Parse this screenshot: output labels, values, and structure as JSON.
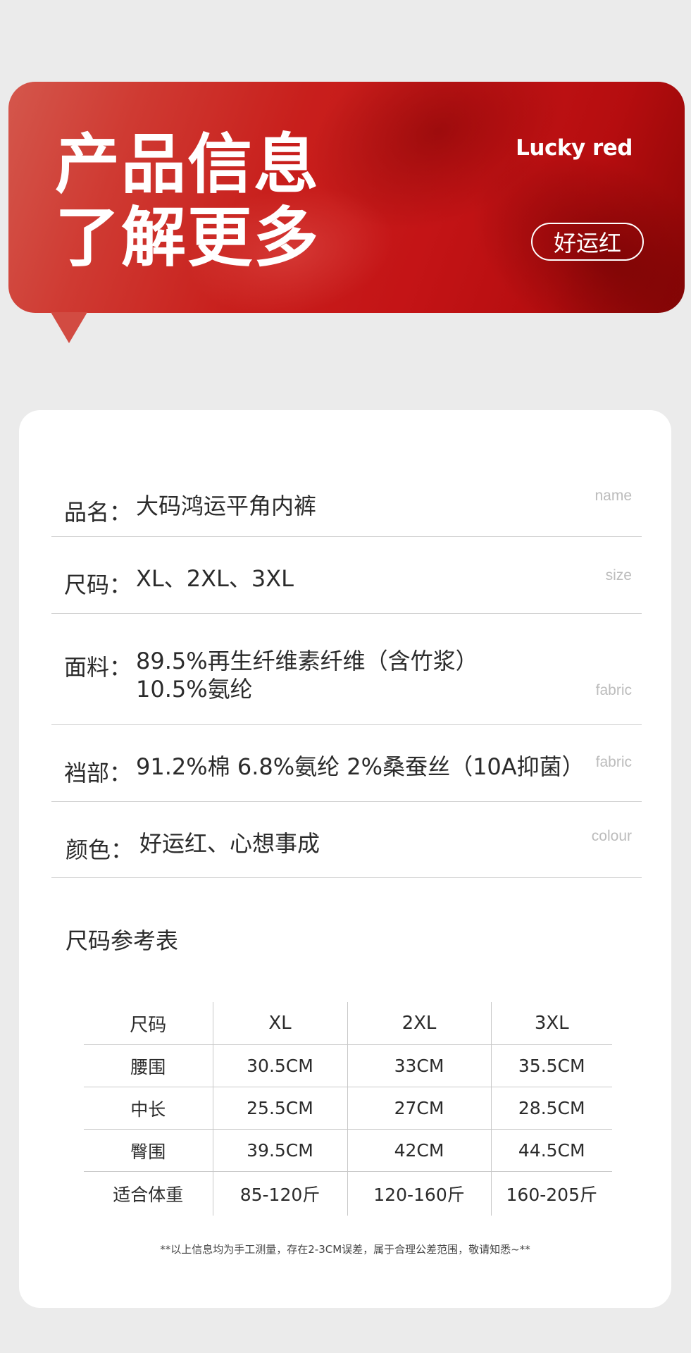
{
  "banner": {
    "title_line1": "产品信息",
    "title_line2": "了解更多",
    "english": "Lucky red",
    "pill": "好运红",
    "color": "#c41416"
  },
  "info": [
    {
      "key": "品名：",
      "value": "大码鸿运平角内裤",
      "en": "name"
    },
    {
      "key": "尺码：",
      "value": "XL、2XL、3XL",
      "en": "size"
    },
    {
      "key": "面料：",
      "value": "89.5%再生纤维素纤维（含竹浆）",
      "value2": "10.5%氨纶",
      "en": "fabric"
    },
    {
      "key": "裆部：",
      "value": "91.2%棉 6.8%氨纶  2%桑蚕丝（10A抑菌）",
      "en": "fabric"
    },
    {
      "key": "颜色：",
      "value": "好运红、心想事成",
      "en": "colour"
    }
  ],
  "size_chart": {
    "title": "尺码参考表",
    "headers": [
      "尺码",
      "XL",
      "2XL",
      "3XL"
    ],
    "rows": [
      [
        "腰围",
        "30.5CM",
        "33CM",
        "35.5CM"
      ],
      [
        "中长",
        "25.5CM",
        "27CM",
        "28.5CM"
      ],
      [
        "臀围",
        "39.5CM",
        "42CM",
        "44.5CM"
      ],
      [
        "适合体重",
        "85-120斤",
        "120-160斤",
        "160-205斤"
      ]
    ]
  },
  "note": "**以上信息均为手工测量，存在2-3CM误差，属于合理公差范围，敬请知悉~**"
}
